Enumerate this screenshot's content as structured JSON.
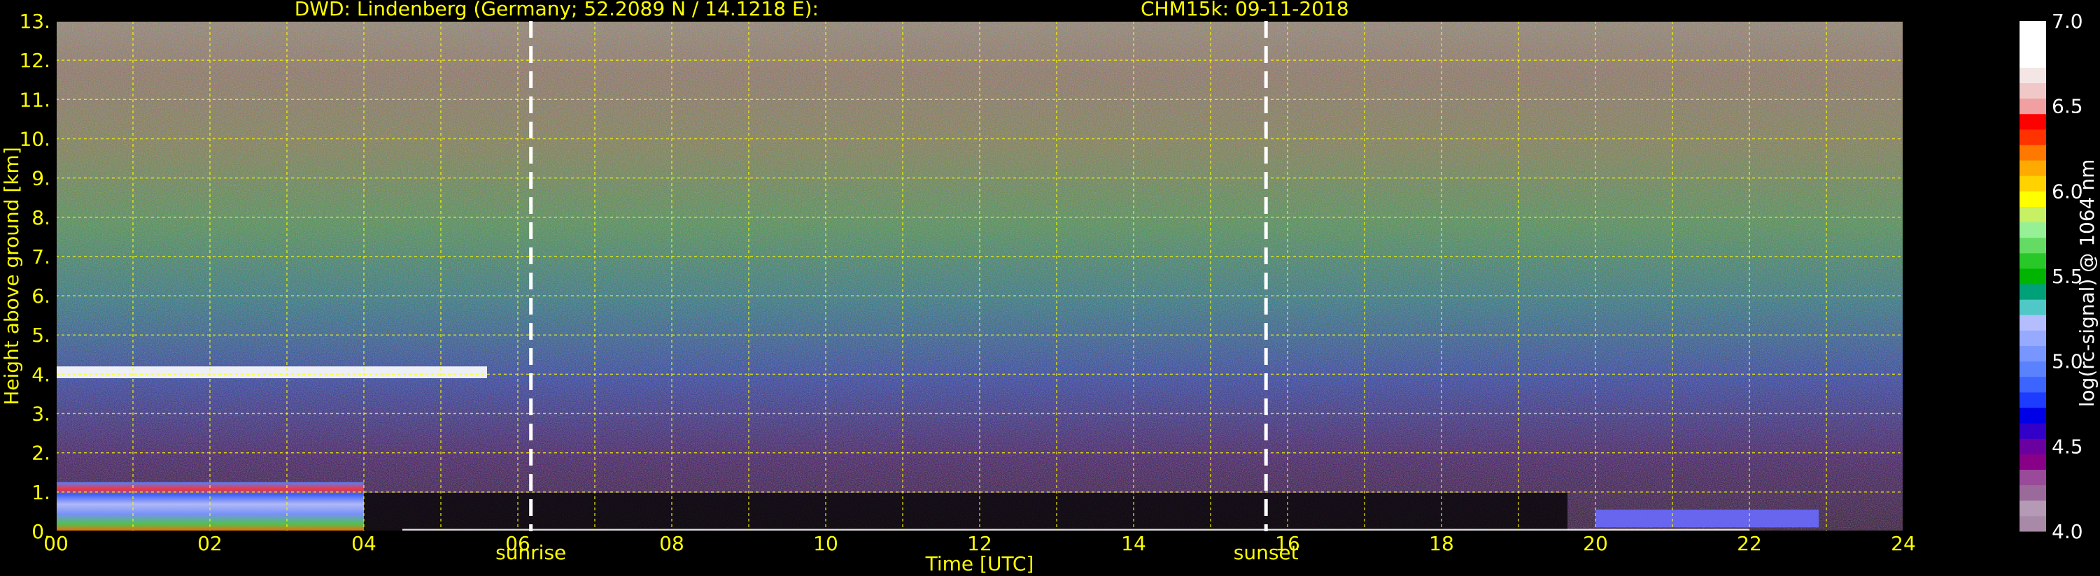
{
  "chart_data": {
    "type": "heatmap",
    "title_left": "DWD: Lindenberg (Germany; 52.2089 N / 14.1218 E):",
    "title_right": "CHM15k: 09-11-2018",
    "xlabel": "Time [UTC]",
    "ylabel": "Height above ground [km]",
    "xlim": [
      0,
      24
    ],
    "ylim": [
      0,
      13
    ],
    "x_ticks": [
      "00",
      "02",
      "04",
      "06",
      "08",
      "10",
      "12",
      "14",
      "16",
      "18",
      "20",
      "22",
      "24"
    ],
    "y_ticks": [
      "0.",
      "1.",
      "2.",
      "3.",
      "4.",
      "5.",
      "6.",
      "7.",
      "8.",
      "9.",
      "10.",
      "11.",
      "12.",
      "13."
    ],
    "grid": true,
    "events": [
      {
        "label": "sunrise",
        "time_utc": 6.17
      },
      {
        "label": "sunset",
        "time_utc": 15.72
      }
    ],
    "colorbar": {
      "label": "log(rc-signal) @ 1064 nm",
      "range": [
        4.0,
        7.0
      ],
      "ticks": [
        "4.0",
        "4.5",
        "5.0",
        "5.5",
        "6.0",
        "6.5",
        "7.0"
      ],
      "colors": [
        "#a88aa8",
        "#b49ab4",
        "#9a6a9a",
        "#9a4a9a",
        "#880088",
        "#6a00a0",
        "#3200c8",
        "#0000e6",
        "#1e3cff",
        "#3c64ff",
        "#5a82ff",
        "#7896ff",
        "#96aaff",
        "#b4beff",
        "#50c8c8",
        "#00a078",
        "#00b400",
        "#28c828",
        "#64dc64",
        "#96f096",
        "#c8f064",
        "#ffff00",
        "#ffd200",
        "#ffaa00",
        "#ff7800",
        "#ff3200",
        "#ff0000",
        "#f0a0a0",
        "#f0c8c8",
        "#f5e6e6",
        "#ffffff",
        "#ffffff",
        "#ffffff"
      ]
    },
    "features": [
      {
        "name": "cloud layer",
        "t_start": 0.0,
        "t_end": 5.6,
        "height_km": [
          3.9,
          4.2
        ]
      },
      {
        "name": "boundary layer",
        "t_start": 0.0,
        "t_end": 4.0,
        "height_km": [
          0.0,
          1.25
        ]
      },
      {
        "name": "low cloud",
        "t_start": 20.0,
        "t_end": 22.9,
        "height_km": [
          0.1,
          0.55
        ]
      }
    ],
    "colors": {
      "axis_text": "#ffff00",
      "grid": "#ffff00",
      "background": "#000000",
      "event_line": "#ffffff"
    }
  }
}
